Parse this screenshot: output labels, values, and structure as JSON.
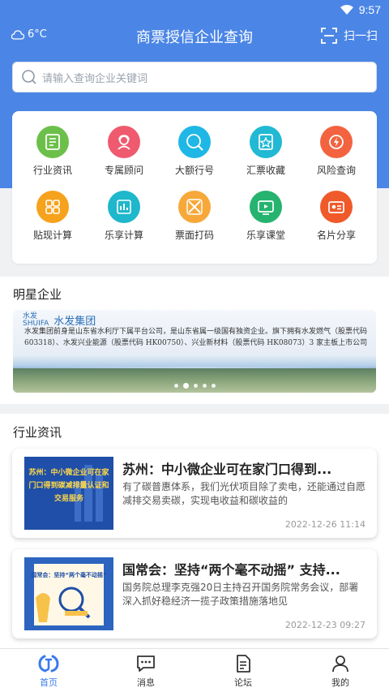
{
  "status_bar": {
    "time": "9:57"
  },
  "header": {
    "weather": "6°C",
    "title": "商票授信企业查询",
    "scan_label": "扫一扫"
  },
  "search": {
    "placeholder": "请输入查询企业关键词"
  },
  "menu": [
    {
      "label": "行业资讯",
      "icon": "news-icon",
      "color": "#6cc04a"
    },
    {
      "label": "专属顾问",
      "icon": "advisor-icon",
      "color": "#ef5a6e"
    },
    {
      "label": "大额行号",
      "icon": "bank-icon",
      "color": "#1fb8e6"
    },
    {
      "label": "汇票收藏",
      "icon": "star-icon",
      "color": "#21b9d3"
    },
    {
      "label": "风险查询",
      "icon": "risk-icon",
      "color": "#f3633f"
    },
    {
      "label": "贴现计算",
      "icon": "calculator-icon",
      "color": "#f6a21d"
    },
    {
      "label": "乐享计算",
      "icon": "chart-icon",
      "color": "#1fb7cc"
    },
    {
      "label": "票面打码",
      "icon": "mask-icon",
      "color": "#f7a83a"
    },
    {
      "label": "乐享课堂",
      "icon": "video-icon",
      "color": "#26b36f"
    },
    {
      "label": "名片分享",
      "icon": "card-icon",
      "color": "#f05a2a"
    }
  ],
  "star_section": {
    "title": "明星企业",
    "banner": {
      "logo_mark": "水发\nSHUIFA",
      "logo_name": "水发集团",
      "description": "水发集团前身是山东省水利厅下属平台公司，是山东省属一级国有独资企业。旗下拥有水发燃气（股票代码 603318）、水发兴业能源（股票代码 HK00750）、兴业新材料（股票代码 HK08073）3 家主板上市公司"
    },
    "pager": {
      "count": 5,
      "active": 1
    }
  },
  "news_section": {
    "title": "行业资讯",
    "items": [
      {
        "title": "苏州：中小微企业可在家门口得到...",
        "summary": "有了碳普惠体系，我们光伏项目除了卖电，还能通过自愿减排交易卖碳，实现电收益和碳收益的",
        "date": "2022-12-26 11:14",
        "thumb_text": "苏州：中小微企业可在家门口得到碳减排量认证和交易服务"
      },
      {
        "title": "国常会：坚持“两个毫不动摇” 支持...",
        "summary": "国务院总理李克强20日主持召开国务院常务会议，部署深入抓好稳经济一揽子政策措施落地见",
        "date": "2022-12-23 09:27",
        "thumb_text": "国常会：坚持“两个毫不动摇”"
      }
    ]
  },
  "tabbar": [
    {
      "label": "首页",
      "active": true
    },
    {
      "label": "消息",
      "active": false
    },
    {
      "label": "论坛",
      "active": false
    },
    {
      "label": "我的",
      "active": false
    }
  ],
  "colors": {
    "primary": "#4b86e6",
    "tab_active": "#3a7bea"
  }
}
